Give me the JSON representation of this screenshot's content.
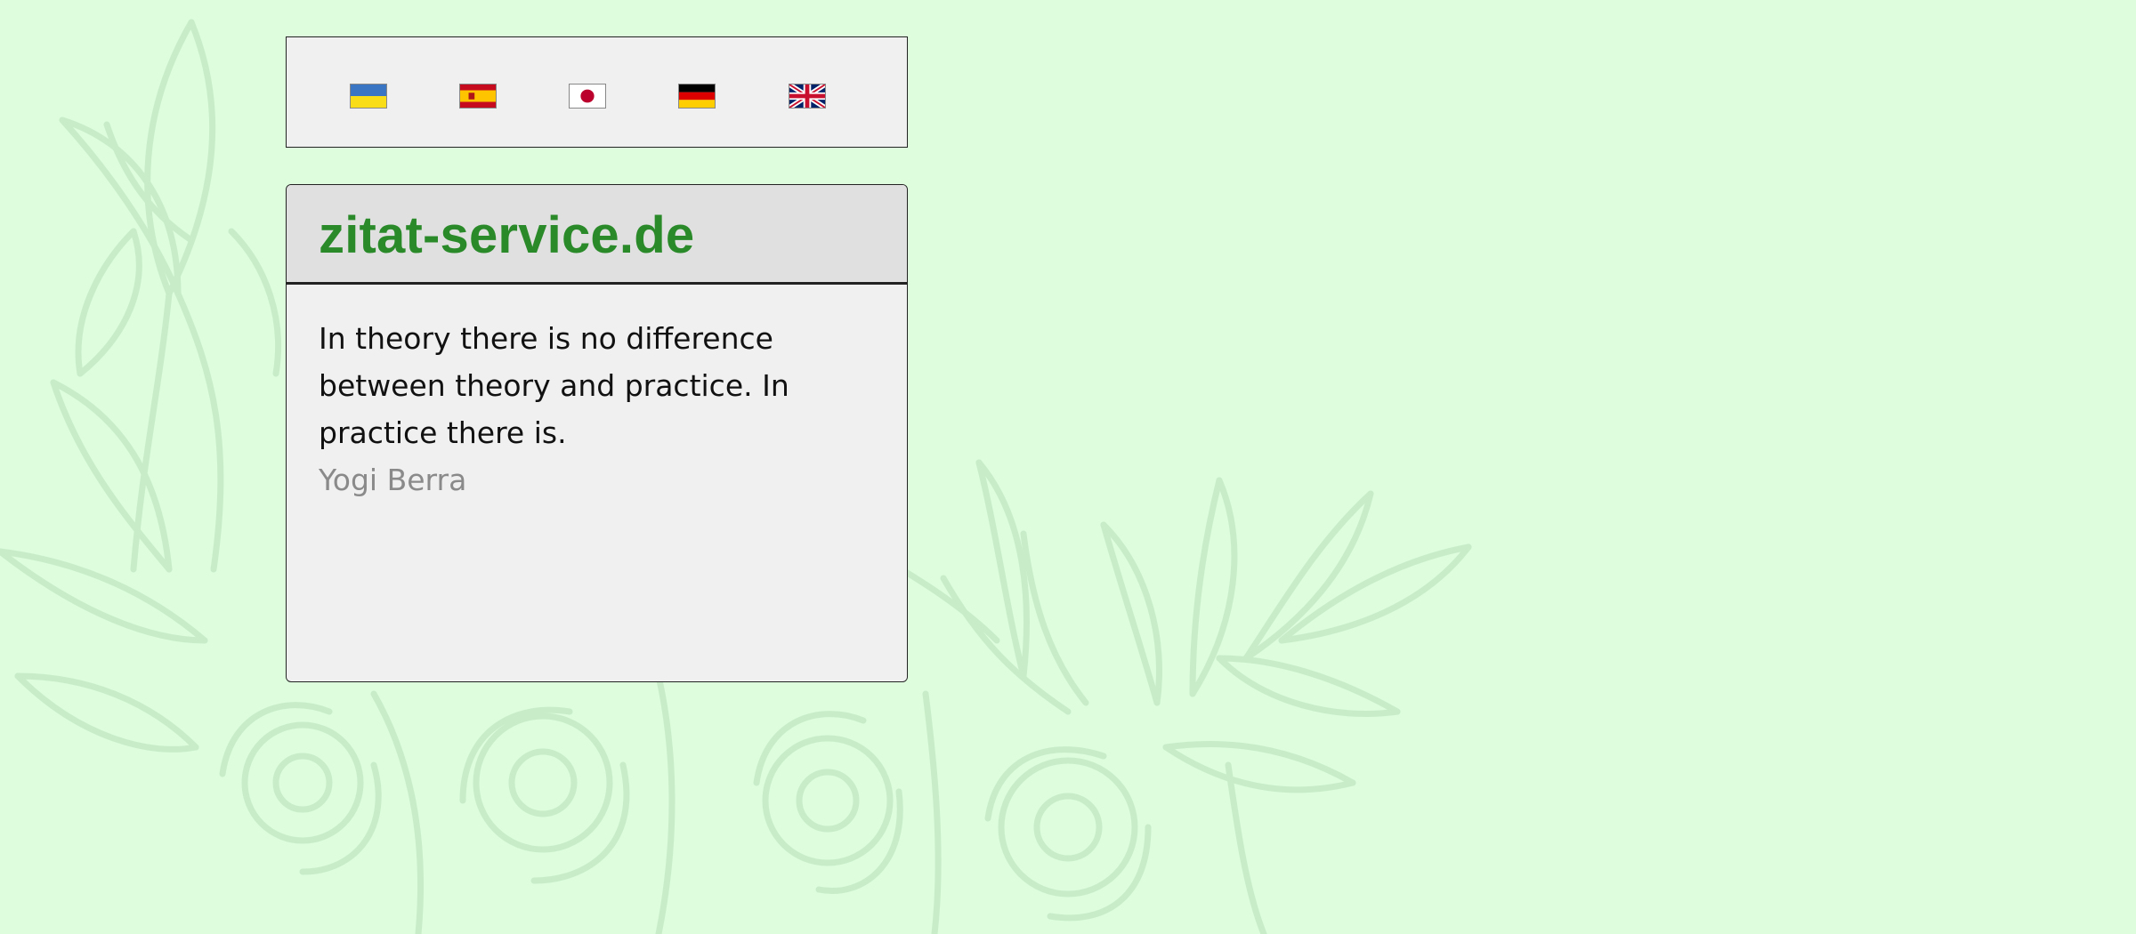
{
  "languages": [
    {
      "name": "ukraine-flag-icon",
      "colors": [
        "#3a75c4",
        "#f9dd16"
      ]
    },
    {
      "name": "spain-flag-icon",
      "colors": [
        "#c60b1e",
        "#ffc400"
      ]
    },
    {
      "name": "japan-flag-icon",
      "colors": [
        "#ffffff",
        "#bc002d"
      ]
    },
    {
      "name": "germany-flag-icon",
      "colors": [
        "#000000",
        "#dd0000",
        "#ffce00"
      ]
    },
    {
      "name": "uk-flag-icon",
      "colors": [
        "#012169",
        "#ffffff",
        "#c8102e"
      ]
    }
  ],
  "site": {
    "title": "zitat-service.de"
  },
  "quote": {
    "text": "In theory there is no difference between theory and practice. In practice there is.",
    "author": "Yogi Berra"
  },
  "colors": {
    "background": "#ddfddd",
    "title": "#2a8a2a",
    "author": "#8a8a8a",
    "panel": "#f0f0f0",
    "header": "#e0e0e0"
  }
}
